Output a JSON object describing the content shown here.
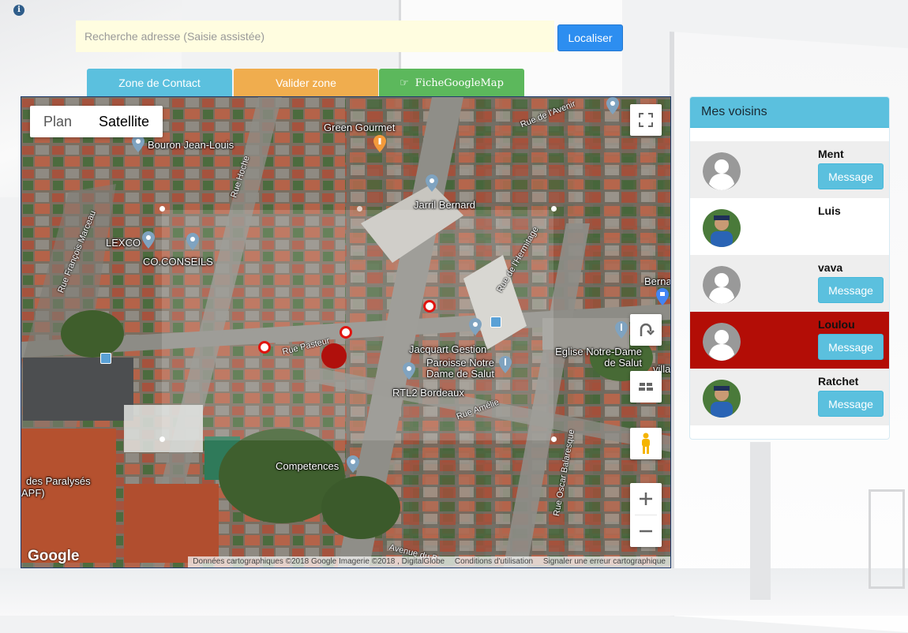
{
  "search": {
    "placeholder": "Recherche adresse (Saisie assistée)",
    "value": "",
    "button_label": "Localiser"
  },
  "tabs": [
    {
      "label": "Zone de Contact",
      "color": "#5bc0de"
    },
    {
      "label": "Valider zone",
      "color": "#f0ad4e"
    },
    {
      "label": "FicheGoogleMap",
      "color": "#5cb85c",
      "icon": "hand-pointing-icon"
    }
  ],
  "map": {
    "map_type_options": [
      "Plan",
      "Satellite"
    ],
    "selected_map_type": "Satellite",
    "places": [
      "Green Gourmet",
      "Bouron Jean-Louis",
      "Jarril Bernard",
      "LEXCO",
      "CO.CONSEILS",
      "Jacquart Gestion",
      "Paroisse Notre Dame de Salut",
      "RTL2 Bordeaux",
      "Eglise Notre-Dame de Salut",
      "Competences",
      "Berna",
      "villa",
      "des Paralysés",
      "APF)"
    ],
    "streets": [
      "Rue de l'Avenir",
      "Rue Hoche",
      "Rue François Marceau",
      "Rue de l'Hermitage",
      "Rue Pasteur",
      "Rue Amélie",
      "Rue Oscar Balaresque",
      "Avenue du B"
    ],
    "logo": "Google",
    "attribution": {
      "data": "Données cartographiques ©2018 Google Imagerie ©2018 , DigitalGlobe",
      "terms": "Conditions d'utilisation",
      "report": "Signaler une erreur cartographique"
    },
    "accent_marker_color": "#b0100c"
  },
  "neighbours": {
    "title": "Mes voisins",
    "message_label": "Message",
    "items": [
      {
        "name": "Ment",
        "has_message_button": true,
        "avatar": "default-user-icon",
        "highlight": false
      },
      {
        "name": "Luis",
        "has_message_button": false,
        "avatar": "photo-avatar",
        "highlight": false
      },
      {
        "name": "vava",
        "has_message_button": true,
        "avatar": "default-user-icon",
        "highlight": false
      },
      {
        "name": "Loulou",
        "has_message_button": true,
        "avatar": "default-user-icon",
        "highlight": true
      },
      {
        "name": "Ratchet",
        "has_message_button": true,
        "avatar": "photo-avatar",
        "highlight": false
      }
    ],
    "highlight_color": "#b30d06"
  }
}
